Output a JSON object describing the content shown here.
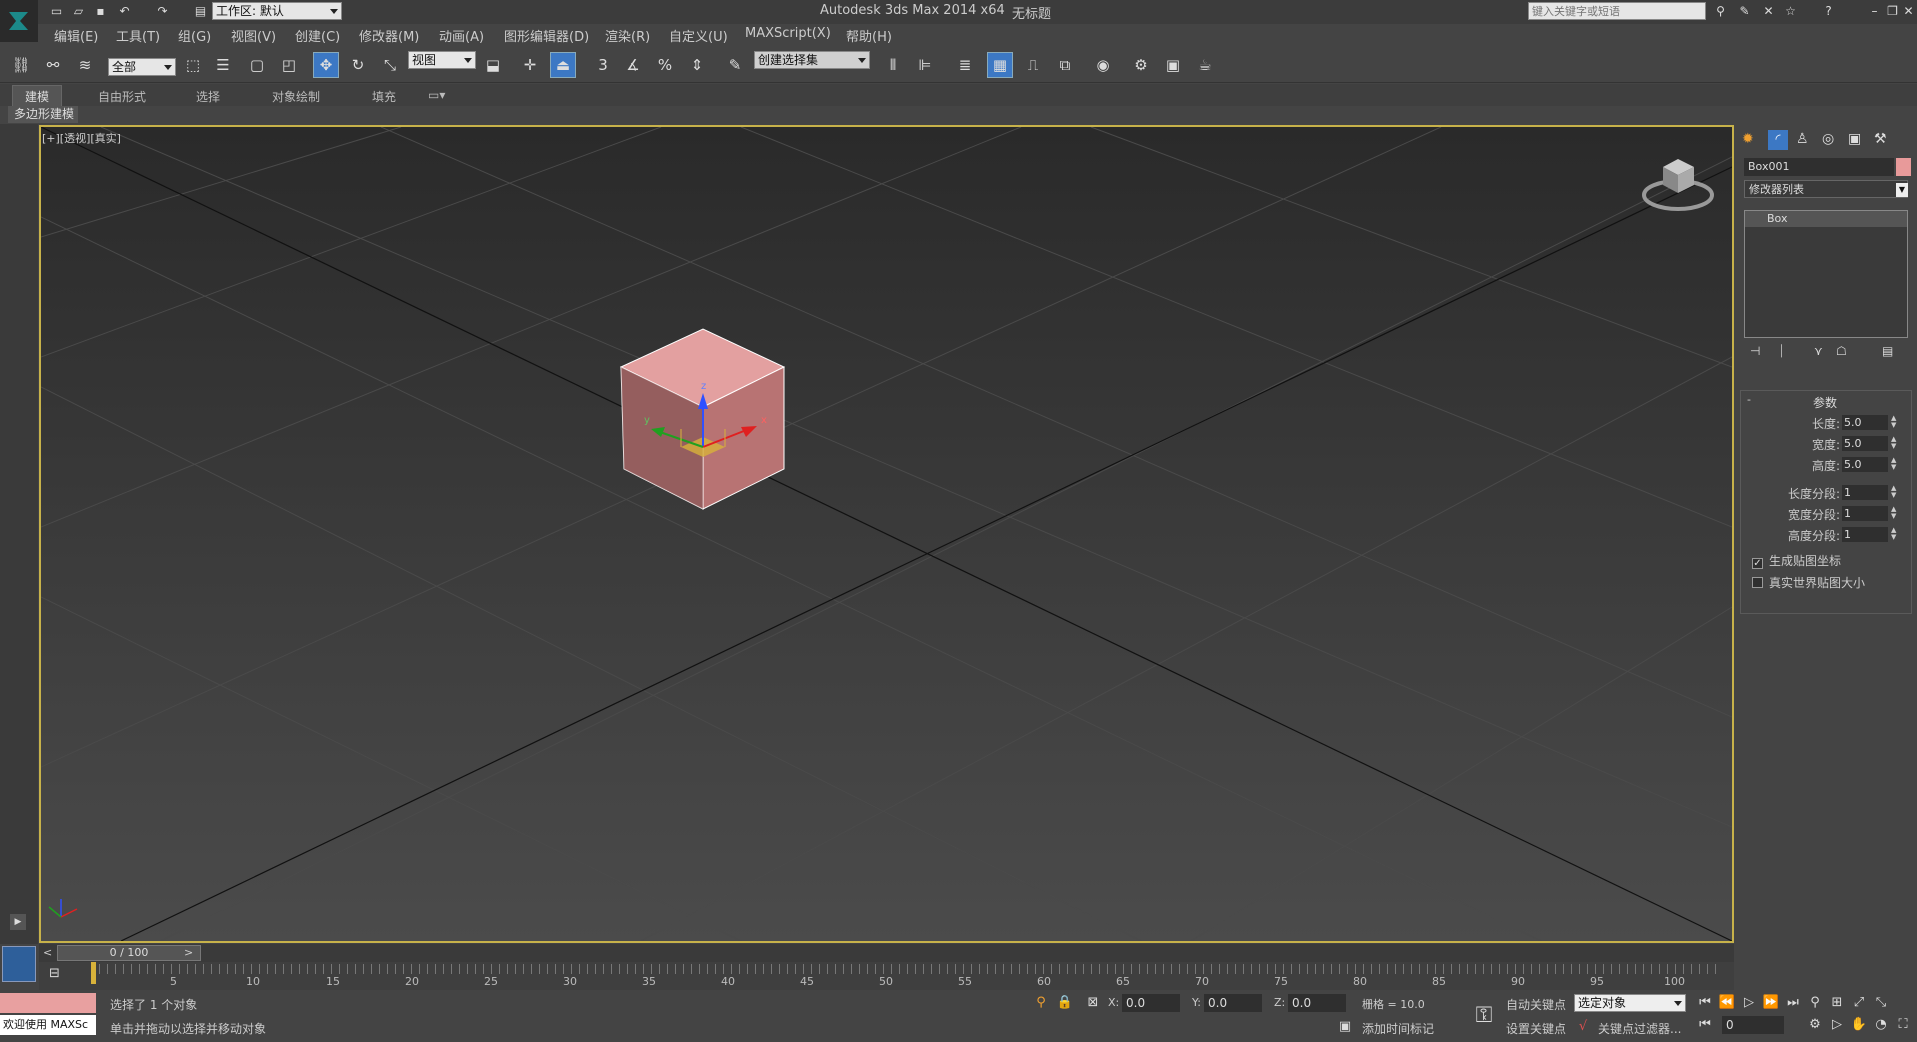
{
  "title": {
    "app": "Autodesk 3ds Max  2014 x64",
    "doc": "无标题",
    "workspace": "工作区: 默认",
    "search_placeholder": "键入关键字或短语"
  },
  "menu": [
    "编辑(E)",
    "工具(T)",
    "组(G)",
    "视图(V)",
    "创建(C)",
    "修改器(M)",
    "动画(A)",
    "图形编辑器(D)",
    "渲染(R)",
    "自定义(U)",
    "MAXScript(X)",
    "帮助(H)"
  ],
  "toolbar": {
    "filter": "全部",
    "ref_coord": "视图",
    "selection_set": "创建选择集",
    "snap_3": "3",
    "snap_percent": "%"
  },
  "ribbon": {
    "tabs": [
      "建模",
      "自由形式",
      "选择",
      "对象绘制",
      "填充"
    ],
    "sub": "多边形建模"
  },
  "viewport": {
    "label": "[+][透视][真实]",
    "axis_z": "z",
    "axis_y": "y",
    "axis_x": "x"
  },
  "command_panel": {
    "object_name": "Box001",
    "modifier_list": "修改器列表",
    "stack_item": "Box",
    "rollout_title": "参数",
    "rollout_toggle": "-",
    "params": [
      {
        "label": "长度:",
        "value": "5.0"
      },
      {
        "label": "宽度:",
        "value": "5.0"
      },
      {
        "label": "高度:",
        "value": "5.0"
      },
      {
        "label": "长度分段:",
        "value": "1"
      },
      {
        "label": "宽度分段:",
        "value": "1"
      },
      {
        "label": "高度分段:",
        "value": "1"
      }
    ],
    "checks": [
      {
        "label": "生成贴图坐标",
        "checked": true
      },
      {
        "label": "真实世界贴图大小",
        "checked": false
      }
    ],
    "object_color": "#e89a9a"
  },
  "timeline": {
    "frame": "0 / 100",
    "prev": "<",
    "next": ">",
    "ticks": [
      "5",
      "10",
      "15",
      "20",
      "25",
      "30",
      "35",
      "40",
      "45",
      "50",
      "55",
      "60",
      "65",
      "70",
      "75",
      "80",
      "85",
      "90",
      "95",
      "100"
    ]
  },
  "status": {
    "selected": "选择了 1 个对象",
    "prompt": "单击并拖动以选择并移动对象",
    "welcome": "欢迎使用 MAXSc",
    "x_label": "X:",
    "x_value": "0.0",
    "y_label": "Y:",
    "y_value": "0.0",
    "z_label": "Z:",
    "z_value": "0.0",
    "grid": "栅格 = 10.0",
    "auto_key": "自动关键点",
    "set_key": "设置关键点",
    "selected_object": "选定对象",
    "key_filters": "关键点过滤器...",
    "add_time_tag": "添加时间标记",
    "frame_field": "0"
  },
  "colors": {
    "accent": "#3c78c4",
    "viewport_border": "#c7b24a",
    "box_front": "#d48a8a",
    "box_top": "#e3a0a0",
    "box_side": "#b87373"
  }
}
